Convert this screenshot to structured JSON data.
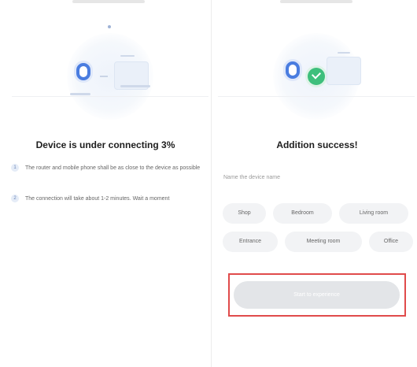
{
  "left_panel": {
    "title": "Device is under connecting 3%",
    "tips": [
      {
        "num": "1",
        "text": "The router and mobile phone shall be as close to the device as possible"
      },
      {
        "num": "2",
        "text": "The connection will take about 1-2 minutes. Wait a moment"
      }
    ]
  },
  "right_panel": {
    "title": "Addition success!",
    "name_hint": "Name the device name",
    "rooms": [
      "Shop",
      "Bedroom",
      "Living room",
      "Entrance",
      "Meeting room",
      "Office"
    ],
    "action_button": "Start to experience"
  },
  "colors": {
    "accent_blue": "#4a7de0",
    "success_green": "#3ebf7c",
    "highlight_red": "#e04b4b",
    "button_disabled": "#e3e5e8"
  },
  "icons": {
    "connecting_illustration": "phone-to-router-icon",
    "success_illustration": "phone-router-success-icon",
    "check": "check-circle-icon"
  }
}
